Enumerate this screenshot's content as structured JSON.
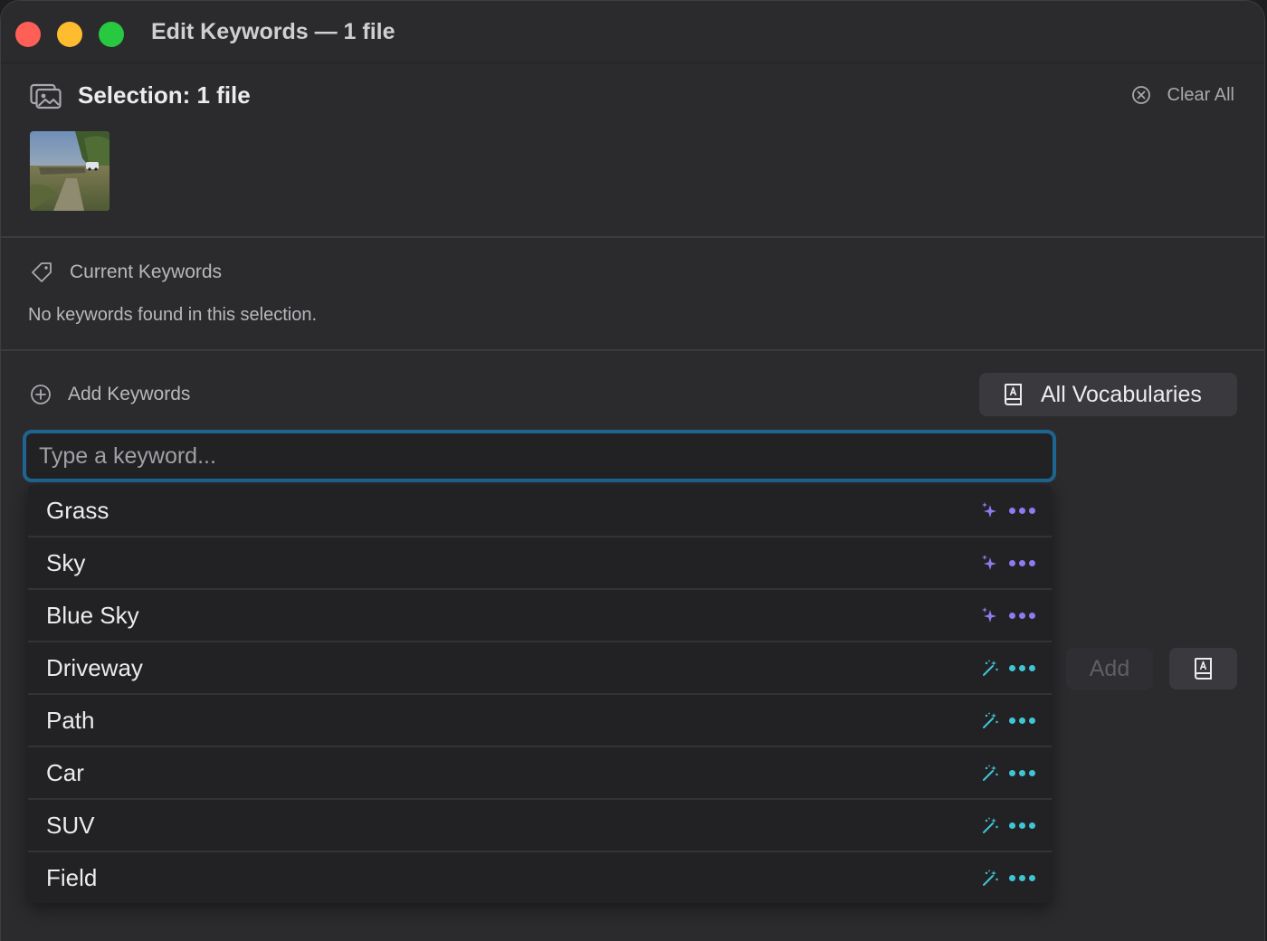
{
  "window": {
    "title": "Edit Keywords — 1 file"
  },
  "selection": {
    "title": "Selection: 1 file",
    "clear_all_label": "Clear All"
  },
  "current_keywords": {
    "heading": "Current Keywords",
    "empty_message": "No keywords found in this selection."
  },
  "add_keywords": {
    "heading": "Add Keywords",
    "vocabularies_label": "All Vocabularies",
    "input_value": "",
    "input_placeholder": "Type a keyword...",
    "add_button_label": "Add"
  },
  "suggestions": [
    {
      "label": "Grass",
      "icon": "sparkles-icon"
    },
    {
      "label": "Sky",
      "icon": "sparkles-icon"
    },
    {
      "label": "Blue Sky",
      "icon": "sparkles-icon"
    },
    {
      "label": "Driveway",
      "icon": "magic-wand-icon"
    },
    {
      "label": "Path",
      "icon": "magic-wand-icon"
    },
    {
      "label": "Car",
      "icon": "magic-wand-icon"
    },
    {
      "label": "SUV",
      "icon": "magic-wand-icon"
    },
    {
      "label": "Field",
      "icon": "magic-wand-icon"
    }
  ],
  "colors": {
    "sparkle_accent": "#8c7cf0",
    "wand_accent": "#3fc6d6",
    "input_focus_ring": "#1f6591"
  }
}
